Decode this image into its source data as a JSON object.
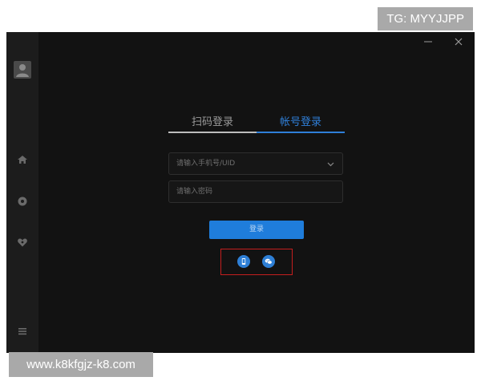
{
  "watermarks": {
    "top": "TG: MYYJJPP",
    "bottom": "www.k8kfgjz-k8.com"
  },
  "sidebar": {
    "icons": [
      "user-avatar-icon",
      "home-icon",
      "circle-icon",
      "heart-icon",
      "menu-icon"
    ]
  },
  "window_controls": {
    "minimize": "—",
    "close": "×"
  },
  "tabs": {
    "qr_label": "扫码登录",
    "account_label": "帐号登录",
    "active": "account"
  },
  "form": {
    "phone_placeholder": "请输入手机号/UID",
    "password_placeholder": "请输入密码",
    "login_label": "登录"
  },
  "alt_login": {
    "icons": [
      "phone-login-icon",
      "wechat-login-icon"
    ]
  },
  "colors": {
    "accent": "#1f7ddb",
    "window_bg": "#121212",
    "sidebar_bg": "#1c1c1c",
    "highlight_border": "#c41e1e",
    "watermark_bg": "#a9a9a9"
  }
}
